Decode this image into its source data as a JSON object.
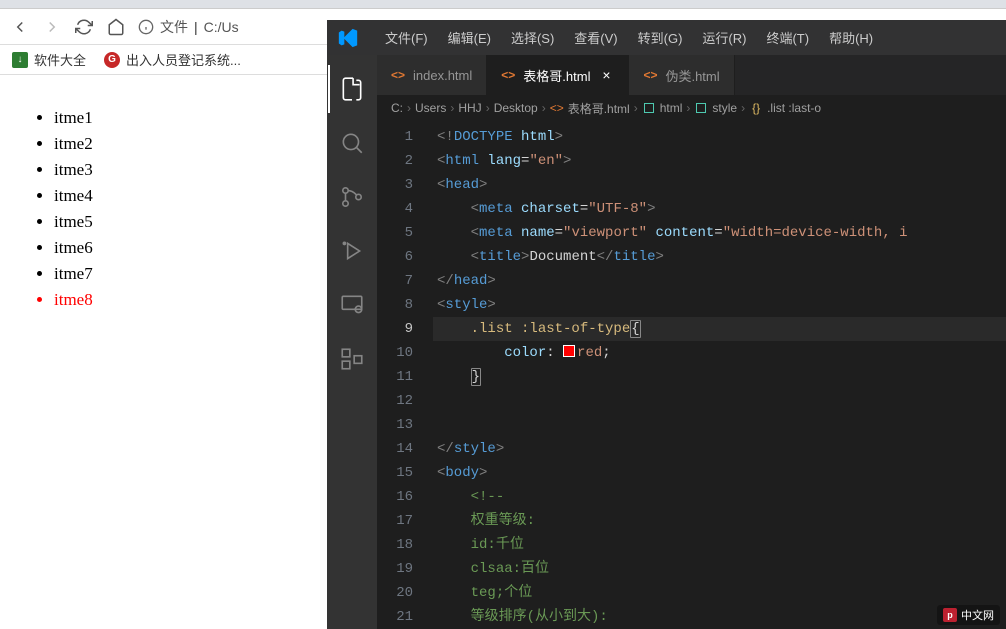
{
  "browser": {
    "nav": {
      "addr_label": "文件",
      "addr_path": "C:/Us"
    },
    "bookmarks": [
      {
        "label": "软件大全",
        "iconClass": "green",
        "iconText": "↓"
      },
      {
        "label": "出入人员登记系统...",
        "iconClass": "red",
        "iconText": "G"
      }
    ]
  },
  "page": {
    "items": [
      "itme1",
      "itme2",
      "itme3",
      "itme4",
      "itme5",
      "itme6",
      "itme7",
      "itme8"
    ]
  },
  "vscode": {
    "menu": [
      "文件(F)",
      "编辑(E)",
      "选择(S)",
      "查看(V)",
      "转到(G)",
      "运行(R)",
      "终端(T)",
      "帮助(H)"
    ],
    "tabs": [
      {
        "label": "index.html",
        "active": false,
        "close": false
      },
      {
        "label": "表格哥.html",
        "active": true,
        "close": true
      },
      {
        "label": "伪类.html",
        "active": false,
        "close": false
      }
    ],
    "breadcrumbs": [
      "C:",
      "Users",
      "HHJ",
      "Desktop",
      "表格哥.html",
      "html",
      "style",
      ".list :last-o"
    ],
    "editor": {
      "lines": [
        {
          "n": 1,
          "html": "<span class='p-gray'>&lt;!</span><span class='p-blue'>DOCTYPE</span> <span class='p-attr'>html</span><span class='p-gray'>&gt;</span>"
        },
        {
          "n": 2,
          "html": "<span class='p-gray'>&lt;</span><span class='p-blue'>html</span> <span class='p-attr'>lang</span>=<span class='p-str'>\"en\"</span><span class='p-gray'>&gt;</span>"
        },
        {
          "n": 3,
          "html": "<span class='p-gray'>&lt;</span><span class='p-blue'>head</span><span class='p-gray'>&gt;</span>"
        },
        {
          "n": 4,
          "html": "    <span class='p-gray'>&lt;</span><span class='p-blue'>meta</span> <span class='p-attr'>charset</span>=<span class='p-str'>\"UTF-8\"</span><span class='p-gray'>&gt;</span>"
        },
        {
          "n": 5,
          "html": "    <span class='p-gray'>&lt;</span><span class='p-blue'>meta</span> <span class='p-attr'>name</span>=<span class='p-str'>\"viewport\"</span> <span class='p-attr'>content</span>=<span class='p-str'>\"width=device-width, i</span>"
        },
        {
          "n": 6,
          "html": "    <span class='p-gray'>&lt;</span><span class='p-blue'>title</span><span class='p-gray'>&gt;</span><span class='p-text'>Document</span><span class='p-gray'>&lt;/</span><span class='p-blue'>title</span><span class='p-gray'>&gt;</span>"
        },
        {
          "n": 7,
          "html": "<span class='p-gray'>&lt;/</span><span class='p-blue'>head</span><span class='p-gray'>&gt;</span>"
        },
        {
          "n": 8,
          "html": "<span class='p-gray'>&lt;</span><span class='p-blue'>style</span><span class='p-gray'>&gt;</span>"
        },
        {
          "n": 9,
          "html": "    <span class='p-yellow'>.list :last-of-type</span><span class='bracket-hl'>{</span>",
          "hl": true
        },
        {
          "n": 10,
          "html": "        <span class='p-attr'>color</span>: <span class='color-swatch'></span><span class='p-str'>red</span>;"
        },
        {
          "n": 11,
          "html": "    <span class='bracket-hl'>}</span>"
        },
        {
          "n": 12,
          "html": ""
        },
        {
          "n": 13,
          "html": ""
        },
        {
          "n": 14,
          "html": "<span class='p-gray'>&lt;/</span><span class='p-blue'>style</span><span class='p-gray'>&gt;</span>"
        },
        {
          "n": 15,
          "html": "<span class='p-gray'>&lt;</span><span class='p-blue'>body</span><span class='p-gray'>&gt;</span>"
        },
        {
          "n": 16,
          "html": "    <span class='p-comment'>&lt;!--</span>"
        },
        {
          "n": 17,
          "html": "    <span class='p-comment'>权重等级:</span>"
        },
        {
          "n": 18,
          "html": "    <span class='p-comment'>id:千位</span>"
        },
        {
          "n": 19,
          "html": "    <span class='p-comment'>clsaa:百位</span>"
        },
        {
          "n": 20,
          "html": "    <span class='p-comment'>teg;个位</span>"
        },
        {
          "n": 21,
          "html": "    <span class='p-comment'>等级排序(从小到大):</span>"
        }
      ],
      "current_line": 9
    }
  },
  "watermark": {
    "text": "中文网"
  }
}
